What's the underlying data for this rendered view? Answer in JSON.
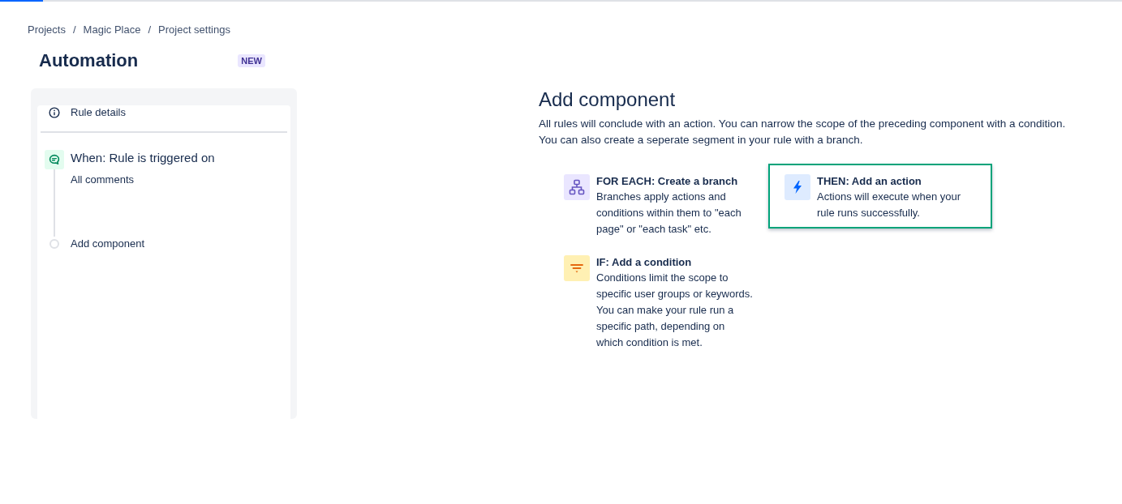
{
  "progress": {
    "level": 0.038
  },
  "breadcrumb": [
    {
      "label": "Projects",
      "separator": "/"
    },
    {
      "label": "Magic Place",
      "separator": "/"
    },
    {
      "label": "Project settings"
    }
  ],
  "page": {
    "title": "Automation",
    "badge": "NEW"
  },
  "rule_panel": {
    "details": "Rule details",
    "trigger": {
      "title": "When: Rule is triggered on",
      "subtitle": "All comments"
    },
    "next_step": "Add component"
  },
  "add_component": {
    "title": "Add component",
    "description": "All rules will conclude with an action. You can narrow the scope of the preceding component with a condition. You can also create a seperate segment in your rule with a branch.",
    "options": [
      {
        "kind": "branch",
        "title": "FOR EACH: Create a branch",
        "description": "Branches apply actions and conditions within them to \"each page\" or \"each task\" etc.",
        "selected": false
      },
      {
        "kind": "action",
        "title": "THEN: Add an action",
        "description": "Actions will execute when your rule runs successfully.",
        "selected": true
      },
      {
        "kind": "condition",
        "title": "IF: Add a condition",
        "description": "Conditions limit the scope to specific user groups or keywords. You can make your rule run a specific path, depending on which condition is met.",
        "selected": false
      }
    ]
  }
}
